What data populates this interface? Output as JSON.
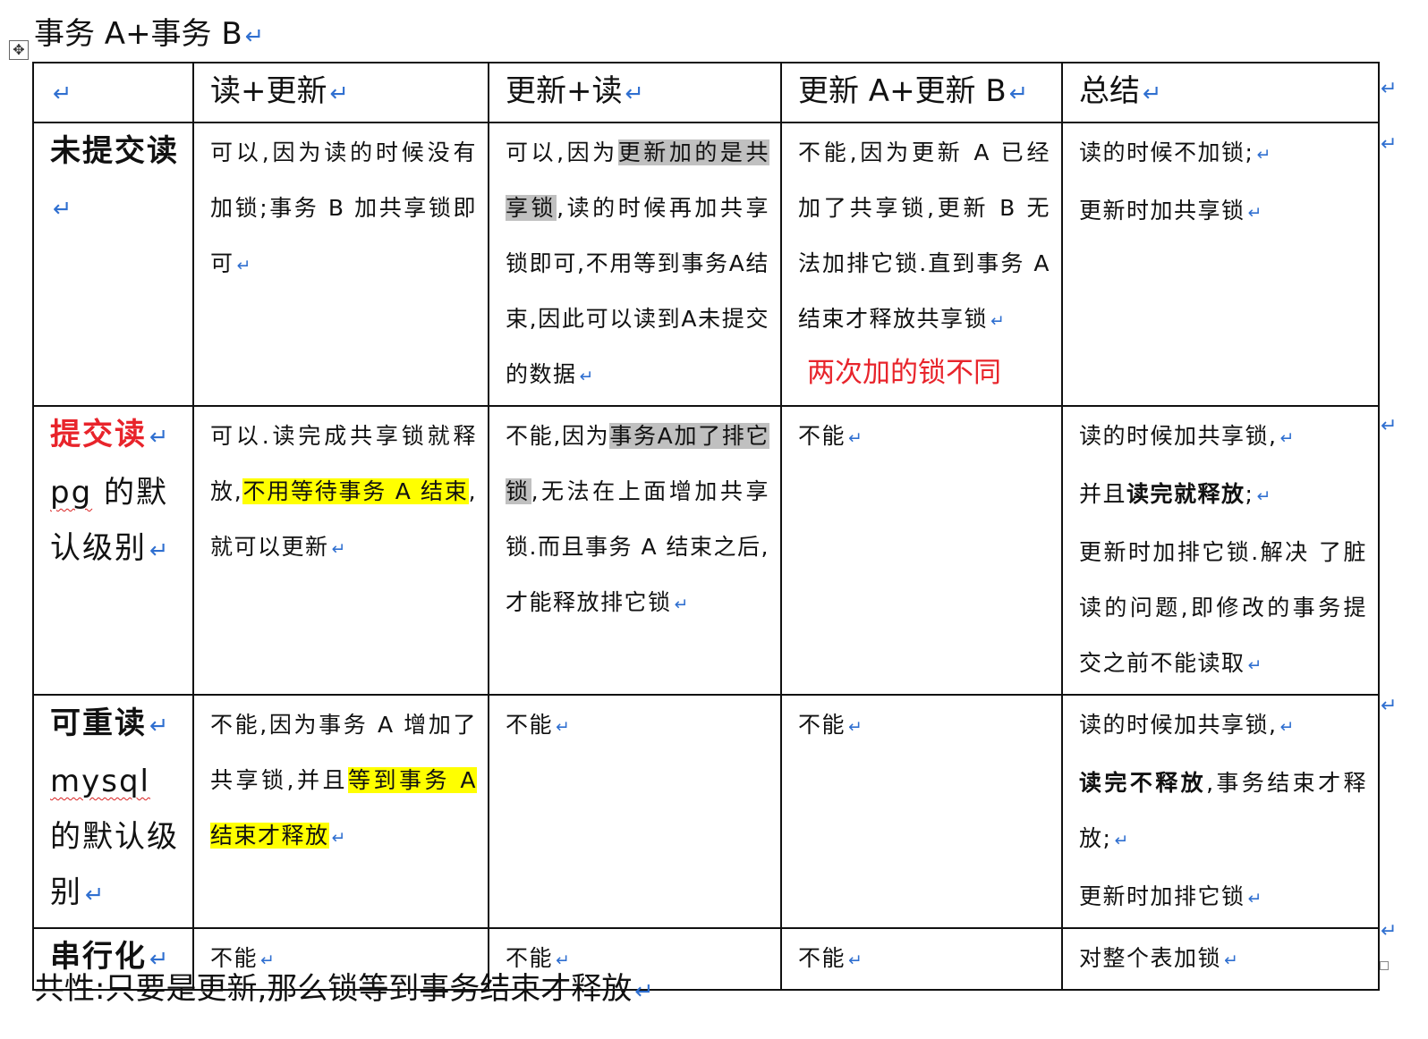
{
  "doc": {
    "title": "事务 A+事务 B",
    "return_mark": "↵",
    "move_handle": "✥",
    "footer": "共性:只要是更新,那么锁等到事务结束才释放"
  },
  "table": {
    "headers": [
      "",
      "读+更新",
      "更新+读",
      "更新 A+更新 B",
      "总结"
    ],
    "rows": [
      {
        "label": {
          "parts": [
            "未提交读"
          ]
        },
        "cells": [
          {
            "text": "可以,因为读的时候没有加锁;事务 B 加共享锁即可"
          },
          {
            "pre": "可以,因为",
            "gray": "更新加的是共享锁",
            "post": ",读的时候再加共享锁即可,不用等到事务A结束,因此可以读到A未提交的数据"
          },
          {
            "text": "不能,因为更新 A 已经加了共享锁,更新 B 无法加排它锁.直到事务 A 结束才释放共享锁",
            "note": "两次加的锁不同"
          },
          {
            "lines": [
              "读的时候不加锁;",
              "更新时加共享锁"
            ]
          }
        ]
      },
      {
        "label": {
          "parts": [
            "提交读",
            "pg",
            "的默认级别"
          ]
        },
        "cells": [
          {
            "pre": "可以.读完成共享锁就释放,",
            "yellow": "不用等待事务 A 结束",
            "post": ",就可以更新"
          },
          {
            "pre": "不能,因为",
            "gray": "事务A加了排它锁",
            "post": ",无法在上面增加共享锁.而且事务 A 结束之后,才能释放排它锁"
          },
          {
            "text": "不能"
          },
          {
            "l1": "读的时候加共享锁,",
            "l2_pre": "并且",
            "l2_bold": "读完就释放",
            "l2_post": ";",
            "l3": "更新时加排它锁.解决 了脏读的问题,即修改的事务提交之前不能读取"
          }
        ]
      },
      {
        "label": {
          "parts": [
            "可重读",
            "mysql",
            "的默认级别"
          ]
        },
        "cells": [
          {
            "pre": "不能,因为事务 A 增加了共享锁,并且",
            "yellow": "等到事务 A 结束才释放",
            "post": ""
          },
          {
            "text": "不能"
          },
          {
            "text": "不能"
          },
          {
            "l1": "读的时候加共享锁,",
            "l2_bold": "读完不释放",
            "l2_post": ",事务结束才释放;",
            "l3": "更新时加排它锁"
          }
        ]
      },
      {
        "label": {
          "parts": [
            "串行化"
          ]
        },
        "cells": [
          {
            "text": "不能"
          },
          {
            "text": "不能"
          },
          {
            "text": "不能"
          },
          {
            "text": "对整个表加锁"
          }
        ]
      }
    ]
  }
}
